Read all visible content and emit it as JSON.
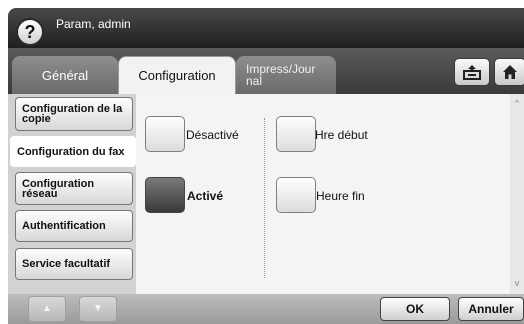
{
  "header": {
    "title": "Param, admin",
    "help_icon": "question-mark-icon",
    "help_glyph": "?"
  },
  "tabs": [
    {
      "label": "Général"
    },
    {
      "label": "Configuration"
    },
    {
      "label": "Impress/Jour\nnal"
    }
  ],
  "toolbar": {
    "export_icon": "tray-export-icon",
    "home_icon": "home-icon"
  },
  "sidebar": {
    "items": [
      {
        "label": "Configuration de la copie"
      },
      {
        "label": "Configuration du fax"
      },
      {
        "label": "Configuration réseau"
      },
      {
        "label": "Authentification"
      },
      {
        "label": "Service facultatif"
      }
    ],
    "scroll_up_glyph": "▲",
    "scroll_down_glyph": "▼"
  },
  "options": {
    "off_label": "Désactivé",
    "on_label": "Activé",
    "start_label": "Hre début",
    "end_label": "Heure fin"
  },
  "scrollbar": {
    "up_glyph": "^",
    "down_glyph": "v"
  },
  "actions": {
    "ok_label": "OK",
    "cancel_label": "Annuler"
  }
}
